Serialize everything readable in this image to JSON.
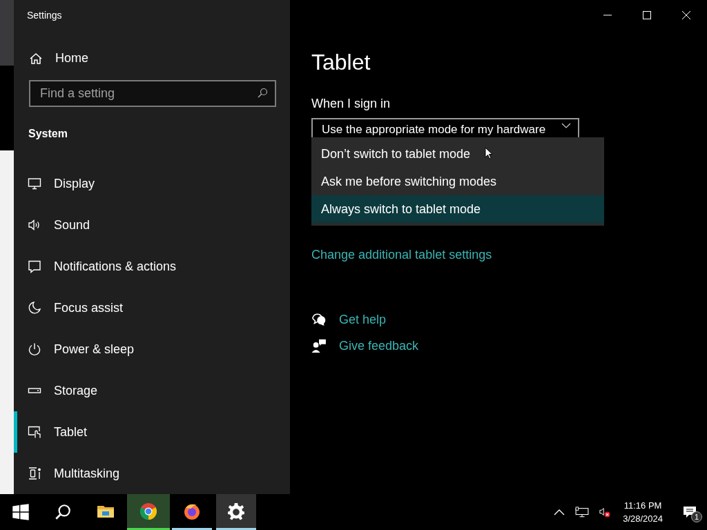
{
  "window": {
    "title": "Settings"
  },
  "sidebar": {
    "home": "Home",
    "search": {
      "placeholder": "Find a setting"
    },
    "section": "System",
    "items": [
      {
        "label": "Display",
        "kind": "display",
        "selected": false
      },
      {
        "label": "Sound",
        "kind": "sound",
        "selected": false
      },
      {
        "label": "Notifications & actions",
        "kind": "notifications",
        "selected": false
      },
      {
        "label": "Focus assist",
        "kind": "moon",
        "selected": false
      },
      {
        "label": "Power & sleep",
        "kind": "power",
        "selected": false
      },
      {
        "label": "Storage",
        "kind": "storage",
        "selected": false
      },
      {
        "label": "Tablet",
        "kind": "tablet",
        "selected": true
      },
      {
        "label": "Multitasking",
        "kind": "multitasking",
        "selected": false
      }
    ]
  },
  "content": {
    "title": "Tablet",
    "signin_label": "When I sign in",
    "dropdown": {
      "value": "Use the appropriate mode for my hardware",
      "expanded": true,
      "options": [
        {
          "label": "Don’t switch to tablet mode",
          "selected": false
        },
        {
          "label": "Ask me before switching modes",
          "selected": false
        },
        {
          "label": "Always switch to tablet mode",
          "selected": true
        }
      ]
    },
    "link": "Change additional tablet settings",
    "help_links": [
      {
        "label": "Get help",
        "kind": "help"
      },
      {
        "label": "Give feedback",
        "kind": "feedback"
      }
    ]
  },
  "taskbar": {
    "apps": [
      {
        "kind": "explorer",
        "running": false,
        "attention": false,
        "selected": false
      },
      {
        "kind": "chrome",
        "running": true,
        "attention": true,
        "selected": false
      },
      {
        "kind": "firefox",
        "running": true,
        "attention": false,
        "selected": false
      },
      {
        "kind": "settings",
        "running": true,
        "attention": false,
        "selected": true
      }
    ],
    "time": "11:16 PM",
    "date": "3/28/2024",
    "notifications": "1"
  }
}
